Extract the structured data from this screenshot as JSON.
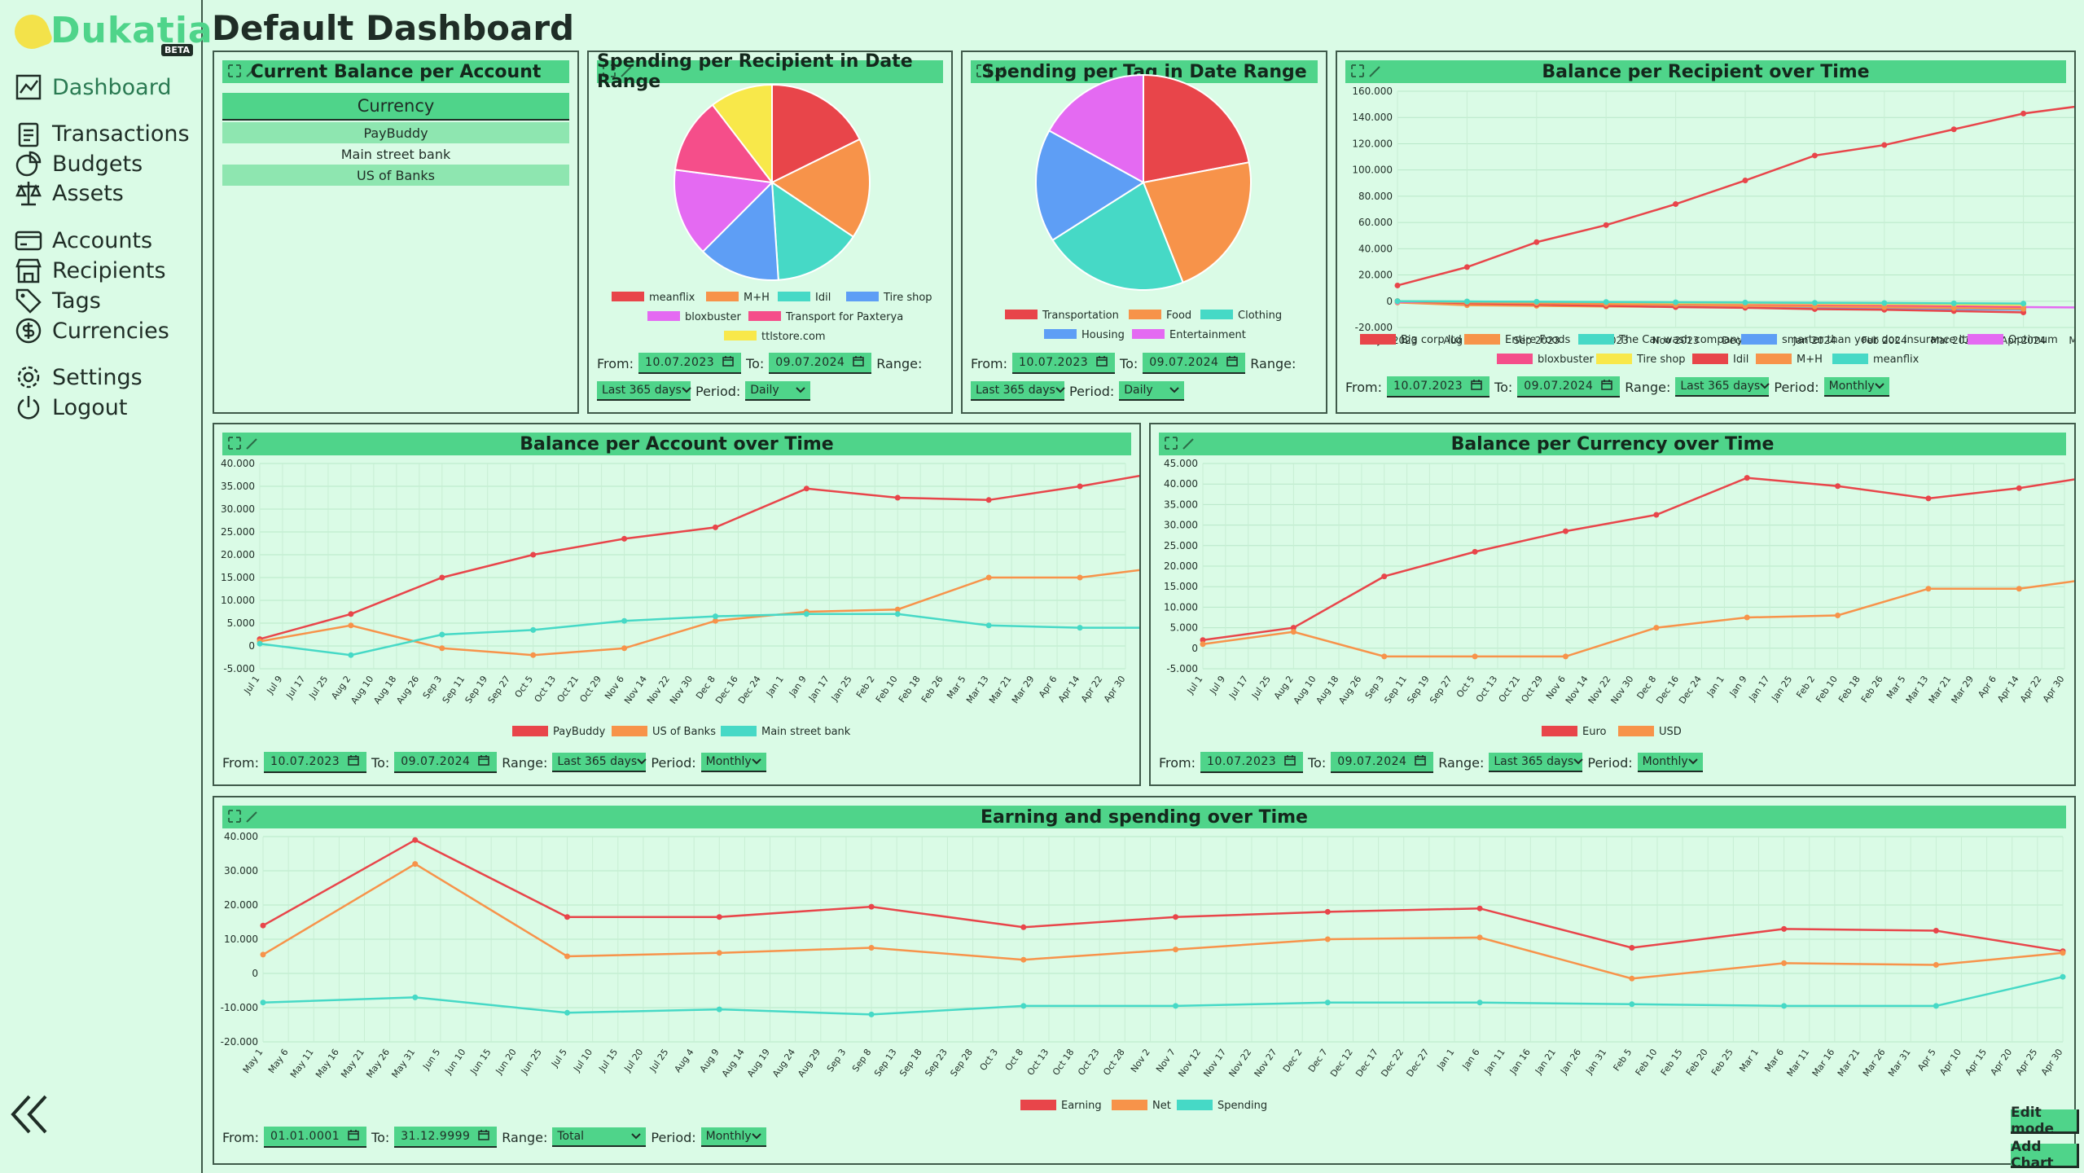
{
  "app": {
    "name": "Dukatia",
    "beta": "BETA"
  },
  "nav": [
    {
      "label": "Dashboard",
      "icon": "chart-line-icon",
      "active": true
    },
    {
      "label": "Transactions",
      "icon": "clipboard-icon"
    },
    {
      "label": "Budgets",
      "icon": "pie-icon"
    },
    {
      "label": "Assets",
      "icon": "scale-icon"
    },
    {
      "label": "Accounts",
      "icon": "card-icon"
    },
    {
      "label": "Recipients",
      "icon": "store-icon"
    },
    {
      "label": "Tags",
      "icon": "tag-icon"
    },
    {
      "label": "Currencies",
      "icon": "dollar-icon"
    },
    {
      "label": "Settings",
      "icon": "gear-icon"
    },
    {
      "label": "Logout",
      "icon": "power-icon"
    }
  ],
  "page": {
    "title": "Default Dashboard"
  },
  "labels": {
    "from": "From:",
    "to": "To:",
    "range": "Range:",
    "period": "Period:"
  },
  "buttons": {
    "edit": "Edit mode",
    "add": "Add Chart"
  },
  "colors": {
    "red": "#e8454a",
    "orange": "#f7934a",
    "teal": "#46d9c6",
    "blue": "#5e9ef5",
    "magenta": "#e46af2",
    "pink": "#f54e8a",
    "yellow": "#f8e84a",
    "accent": "#4fd48a"
  },
  "accounts_table": {
    "title": "Current Balance per Account",
    "header": "Currency",
    "rows": [
      "PayBuddy",
      "Main street bank",
      "US of Banks"
    ]
  },
  "pie_recipients": {
    "title": "Spending per Recipient in Date Range",
    "controls": {
      "from": "10.07.2023",
      "to": "09.07.2024",
      "range": "Last 365 days",
      "period": "Daily"
    }
  },
  "pie_tags": {
    "title": "Spending per Tag in Date Range",
    "controls": {
      "from": "10.07.2023",
      "to": "09.07.2024",
      "range": "Last 365 days",
      "period": "Daily"
    }
  },
  "line_recipients": {
    "title": "Balance per Recipient over Time",
    "controls": {
      "from": "10.07.2023",
      "to": "09.07.2024",
      "range": "Last 365 days",
      "period": "Monthly"
    }
  },
  "line_accounts": {
    "title": "Balance per Account over Time",
    "controls": {
      "from": "10.07.2023",
      "to": "09.07.2024",
      "range": "Last 365 days",
      "period": "Monthly"
    }
  },
  "line_currency": {
    "title": "Balance per Currency over Time",
    "controls": {
      "from": "10.07.2023",
      "to": "09.07.2024",
      "range": "Last 365 days",
      "period": "Monthly"
    }
  },
  "line_earning": {
    "title": "Earning and spending over Time",
    "controls": {
      "from": "01.01.0001",
      "to": "31.12.9999",
      "range": "Total",
      "period": "Monthly"
    }
  },
  "chart_data": [
    {
      "id": "pie_recipients",
      "type": "pie",
      "title": "Spending per Recipient in Date Range",
      "labels": [
        "meanflix",
        "M+H",
        "Idil",
        "Tire shop",
        "bloxbuster",
        "Transport for Paxterya",
        "ttlstore.com"
      ],
      "values": [
        17,
        16,
        14,
        13,
        14,
        12,
        10
      ],
      "colors": [
        "#e8454a",
        "#f7934a",
        "#46d9c6",
        "#5e9ef5",
        "#e46af2",
        "#f54e8a",
        "#f8e84a"
      ]
    },
    {
      "id": "pie_tags",
      "type": "pie",
      "title": "Spending per Tag in Date Range",
      "labels": [
        "Transportation",
        "Food",
        "Clothing",
        "Housing",
        "Entertainment"
      ],
      "values": [
        22,
        22,
        22,
        17,
        17
      ],
      "colors": [
        "#e8454a",
        "#f7934a",
        "#46d9c6",
        "#5e9ef5",
        "#e46af2"
      ]
    },
    {
      "id": "line_recipients",
      "type": "line",
      "title": "Balance per Recipient over Time",
      "x": [
        "Jul 2023",
        "Aug 2023",
        "Sep 2023",
        "Oct 2023",
        "Nov 2023",
        "Dec 2023",
        "Jan 2024",
        "Feb 2024",
        "Mar 2024",
        "Apr 2024",
        "May 2024"
      ],
      "yticks": [
        "160.000",
        "140.000",
        "120.000",
        "100.000",
        "80.000",
        "60.000",
        "40.000",
        "20.000",
        "0",
        "-20.000"
      ],
      "ylim": [
        -20000,
        160000
      ],
      "series": [
        {
          "name": "Big corp ltd",
          "color": "#e8454a",
          "values": [
            12000,
            26000,
            45000,
            58000,
            74000,
            92000,
            111000,
            119000,
            131000,
            143000,
            150000
          ]
        },
        {
          "name": "Entire Foods",
          "color": "#f7934a",
          "values": [
            -1000,
            -3000,
            -3500,
            -4000,
            -4200,
            -4500,
            -4600,
            -4800,
            -5000,
            -5200,
            null
          ]
        },
        {
          "name": "The Car wash company",
          "color": "#46d9c6",
          "values": [
            0,
            -200,
            -500,
            -700,
            -900,
            -1200,
            -1500,
            -1800,
            -2000,
            -2200,
            null
          ]
        },
        {
          "name": "smarter than your doc insurance ltd",
          "color": "#5e9ef5",
          "values": [
            0,
            -1000,
            -2000,
            -3000,
            -4000,
            -4500,
            -5000,
            -5500,
            -6000,
            -6500,
            null
          ]
        },
        {
          "name": "Optimum",
          "color": "#e46af2",
          "values": [
            -500,
            -1000,
            -1500,
            -2000,
            -2500,
            -3000,
            -3200,
            -3500,
            -4000,
            -4500,
            -4800
          ]
        },
        {
          "name": "bloxbuster",
          "color": "#f54e8a",
          "values": [
            0,
            -500,
            -1000,
            -1500,
            -2000,
            -2500,
            -3000,
            -3500,
            -4000,
            -4500,
            null
          ]
        },
        {
          "name": "Tire shop",
          "color": "#f8e84a",
          "values": [
            0,
            -300,
            -600,
            -900,
            -1200,
            -1500,
            -1800,
            -2100,
            -2400,
            -2700,
            null
          ]
        },
        {
          "name": "Idil",
          "color": "#e8454a",
          "values": [
            0,
            -1500,
            -2500,
            -3500,
            -4500,
            -5000,
            -6000,
            -6500,
            -7500,
            -8500,
            null
          ]
        },
        {
          "name": "M+H",
          "color": "#f7934a",
          "values": [
            0,
            -800,
            -1500,
            -2200,
            -2800,
            -3500,
            -4000,
            -4600,
            -5200,
            -5800,
            null
          ]
        },
        {
          "name": "meanflix",
          "color": "#46d9c6",
          "values": [
            0,
            -200,
            -400,
            -600,
            -800,
            -1000,
            -1200,
            -1400,
            -1600,
            -1800,
            null
          ]
        }
      ]
    },
    {
      "id": "line_accounts",
      "type": "line",
      "title": "Balance per Account over Time",
      "xlabels": [
        "Jul 1",
        "Jul 9",
        "Jul 17",
        "Jul 25",
        "Aug 2",
        "Aug 10",
        "Aug 18",
        "Aug 26",
        "Sep 3",
        "Sep 11",
        "Sep 19",
        "Sep 27",
        "Oct 5",
        "Oct 13",
        "Oct 21",
        "Oct 29",
        "Nov 6",
        "Nov 14",
        "Nov 22",
        "Nov 30",
        "Dec 8",
        "Dec 16",
        "Dec 24",
        "Jan 1",
        "Jan 9",
        "Jan 17",
        "Jan 25",
        "Feb 2",
        "Feb 10",
        "Feb 18",
        "Feb 26",
        "Mar 5",
        "Mar 13",
        "Mar 21",
        "Mar 29",
        "Apr 6",
        "Apr 14",
        "Apr 22",
        "Apr 30"
      ],
      "points_at": [
        0,
        4,
        8,
        12,
        16,
        20,
        24,
        28,
        32,
        36,
        40
      ],
      "yticks": [
        "40.000",
        "35.000",
        "30.000",
        "25.000",
        "20.000",
        "15.000",
        "10.000",
        "5.000",
        "0",
        "-5.000"
      ],
      "ylim": [
        -5000,
        40000
      ],
      "series": [
        {
          "name": "PayBuddy",
          "color": "#e8454a",
          "values": [
            1500,
            7000,
            15000,
            20000,
            23500,
            26000,
            34500,
            32500,
            32000,
            35000,
            38500
          ]
        },
        {
          "name": "US of Banks",
          "color": "#f7934a",
          "values": [
            1000,
            4500,
            -500,
            -2000,
            -500,
            5500,
            7500,
            8000,
            15000,
            15000,
            17500
          ]
        },
        {
          "name": "Main street bank",
          "color": "#46d9c6",
          "values": [
            500,
            -2000,
            2500,
            3500,
            5500,
            6500,
            7000,
            7000,
            4500,
            4000,
            4000
          ]
        }
      ]
    },
    {
      "id": "line_currency",
      "type": "line",
      "title": "Balance per Currency over Time",
      "xlabels": [
        "Jul 1",
        "Jul 9",
        "Jul 17",
        "Jul 25",
        "Aug 2",
        "Aug 10",
        "Aug 18",
        "Aug 26",
        "Sep 3",
        "Sep 11",
        "Sep 19",
        "Sep 27",
        "Oct 5",
        "Oct 13",
        "Oct 21",
        "Oct 29",
        "Nov 6",
        "Nov 14",
        "Nov 22",
        "Nov 30",
        "Dec 8",
        "Dec 16",
        "Dec 24",
        "Jan 1",
        "Jan 9",
        "Jan 17",
        "Jan 25",
        "Feb 2",
        "Feb 10",
        "Feb 18",
        "Feb 26",
        "Mar 5",
        "Mar 13",
        "Mar 21",
        "Mar 29",
        "Apr 6",
        "Apr 14",
        "Apr 22",
        "Apr 30"
      ],
      "points_at": [
        0,
        4,
        8,
        12,
        16,
        20,
        24,
        28,
        32,
        36,
        40
      ],
      "yticks": [
        "45.000",
        "40.000",
        "35.000",
        "30.000",
        "25.000",
        "20.000",
        "15.000",
        "10.000",
        "5.000",
        "0",
        "-5.000"
      ],
      "ylim": [
        -5000,
        45000
      ],
      "series": [
        {
          "name": "Euro",
          "color": "#e8454a",
          "values": [
            2000,
            5000,
            17500,
            23500,
            28500,
            32500,
            41500,
            39500,
            36500,
            39000,
            42500
          ]
        },
        {
          "name": "USD",
          "color": "#f7934a",
          "values": [
            1000,
            4000,
            -2000,
            -2000,
            -2000,
            5000,
            7500,
            8000,
            14500,
            14500,
            17500
          ]
        }
      ]
    },
    {
      "id": "line_earning",
      "type": "line",
      "title": "Earning and spending over Time",
      "xlabels": [
        "May 1",
        "May 6",
        "May 11",
        "May 16",
        "May 21",
        "May 26",
        "May 31",
        "Jun 5",
        "Jun 10",
        "Jun 15",
        "Jun 20",
        "Jun 25",
        "Jul 5",
        "Jul 10",
        "Jul 15",
        "Jul 20",
        "Jul 25",
        "Aug 4",
        "Aug 9",
        "Aug 14",
        "Aug 19",
        "Aug 24",
        "Aug 29",
        "Sep 3",
        "Sep 8",
        "Sep 13",
        "Sep 18",
        "Sep 23",
        "Sep 28",
        "Oct 3",
        "Oct 8",
        "Oct 13",
        "Oct 18",
        "Oct 23",
        "Oct 28",
        "Nov 2",
        "Nov 7",
        "Nov 12",
        "Nov 17",
        "Nov 22",
        "Nov 27",
        "Dec 2",
        "Dec 7",
        "Dec 12",
        "Dec 17",
        "Dec 22",
        "Dec 27",
        "Jan 1",
        "Jan 6",
        "Jan 11",
        "Jan 16",
        "Jan 21",
        "Jan 26",
        "Jan 31",
        "Feb 5",
        "Feb 10",
        "Feb 15",
        "Feb 20",
        "Feb 25",
        "Mar 1",
        "Mar 6",
        "Mar 11",
        "Mar 16",
        "Mar 21",
        "Mar 26",
        "Mar 31",
        "Apr 5",
        "Apr 10",
        "Apr 15",
        "Apr 20",
        "Apr 25",
        "Apr 30"
      ],
      "points_at": [
        0,
        6,
        12,
        18,
        24,
        30,
        36,
        42,
        48,
        54,
        60,
        66,
        71
      ],
      "yticks": [
        "40.000",
        "30.000",
        "20.000",
        "10.000",
        "0",
        "-10.000",
        "-20.000"
      ],
      "ylim": [
        -20000,
        40000
      ],
      "series": [
        {
          "name": "Earning",
          "color": "#e8454a",
          "values": [
            14000,
            39000,
            16500,
            16500,
            19500,
            13500,
            16500,
            18000,
            19000,
            7500,
            13000,
            12500,
            6500
          ]
        },
        {
          "name": "Net",
          "color": "#f7934a",
          "values": [
            5500,
            32000,
            5000,
            6000,
            7500,
            4000,
            7000,
            10000,
            10500,
            -1500,
            3000,
            2500,
            6000
          ]
        },
        {
          "name": "Spending",
          "color": "#46d9c6",
          "values": [
            -8500,
            -7000,
            -11500,
            -10500,
            -12000,
            -9500,
            -9500,
            -8500,
            -8500,
            -9000,
            -9500,
            -9500,
            -1000
          ]
        }
      ]
    }
  ]
}
